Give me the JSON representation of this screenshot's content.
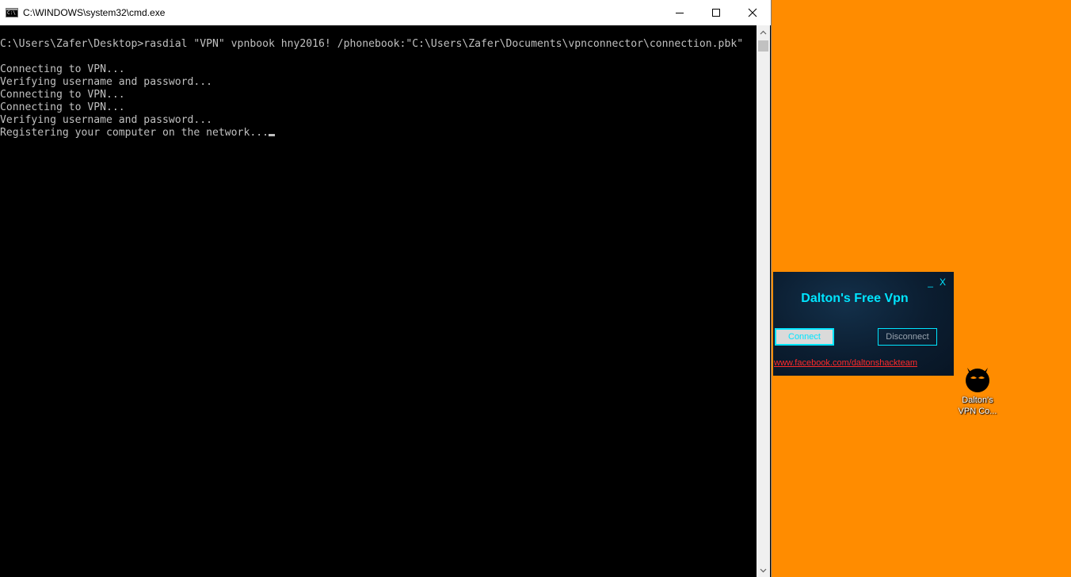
{
  "cmd": {
    "title": "C:\\WINDOWS\\system32\\cmd.exe",
    "lines": [
      "C:\\Users\\Zafer\\Desktop>rasdial \"VPN\" vpnbook hny2016! /phonebook:\"C:\\Users\\Zafer\\Documents\\vpnconnector\\connection.pbk\"",
      "",
      "Connecting to VPN...",
      "Verifying username and password...",
      "Connecting to VPN...",
      "Connecting to VPN...",
      "Verifying username and password...",
      "Registering your computer on the network..."
    ],
    "icons": {
      "app": "cmd-icon",
      "minimize": "minimize-icon",
      "maximize": "maximize-icon",
      "close": "close-icon"
    }
  },
  "vpn": {
    "title": "Dalton's Free Vpn",
    "minimize_label": "_",
    "close_label": "X",
    "connect_label": "Connect",
    "disconnect_label": "Disconnect",
    "link": "www.facebook.com/daltonshackteam",
    "colors": {
      "accent": "#00E5FF",
      "link": "#FF2A2A",
      "background": "#0B1D30"
    }
  },
  "desktop": {
    "background": "#FF8C00",
    "icon": {
      "label_line1": "Dalton's",
      "label_line2": "VPN Co...",
      "icon_name": "devil-face-icon"
    }
  }
}
